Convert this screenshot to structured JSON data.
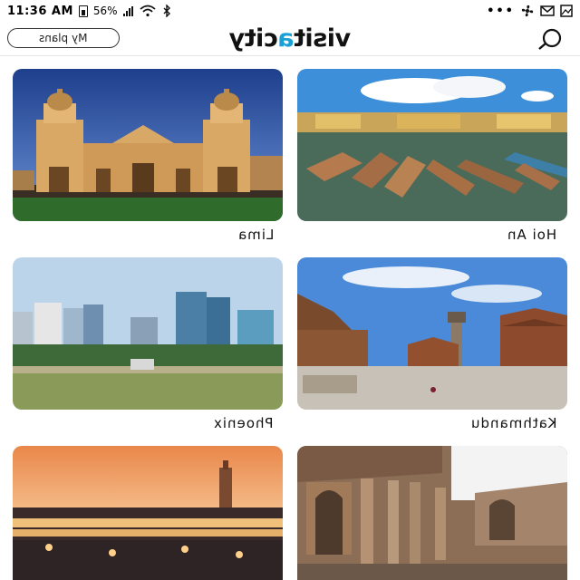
{
  "status_bar": {
    "time": "11:36 AM",
    "battery": "56%",
    "overflow": "•••"
  },
  "header": {
    "my_plans_label": "My plans",
    "logo_text_a": "visit",
    "logo_text_accent": "a",
    "logo_text_b": "city"
  },
  "cities": [
    {
      "name": "Lima",
      "image": "lima-cathedral-photo"
    },
    {
      "name": "Hoi An",
      "image": "hoi-an-boats-photo"
    },
    {
      "name": "Phoenix",
      "image": "phoenix-skyline-photo"
    },
    {
      "name": "Kathmandu",
      "image": "kathmandu-durbar-square-photo"
    },
    {
      "name": "",
      "image": "marrakech-square-photo"
    },
    {
      "name": "",
      "image": "roman-ruins-photo"
    }
  ]
}
